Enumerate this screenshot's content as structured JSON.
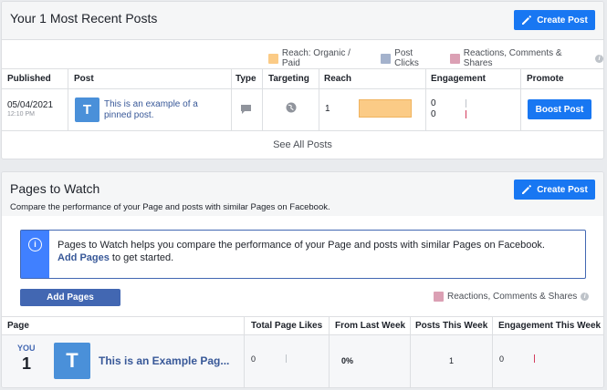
{
  "recent_posts": {
    "title": "Your 1 Most Recent Posts",
    "create_post_label": "Create Post",
    "legend": [
      {
        "label": "Reach: Organic / Paid",
        "color": "#fbcb86"
      },
      {
        "label": "Post Clicks",
        "color": "#a4b2cc"
      },
      {
        "label": "Reactions, Comments & Shares",
        "color": "#dba0b4"
      }
    ],
    "columns": [
      "Published",
      "Post",
      "Type",
      "Targeting",
      "Reach",
      "Engagement",
      "Promote"
    ],
    "row": {
      "date": "05/04/2021",
      "time": "12:10 PM",
      "avatar_letter": "T",
      "post_text": "This is an example of a pinned post.",
      "reach": "1",
      "reach_fraction": 1.0,
      "engagement_clicks": "0",
      "engagement_reactions": "0",
      "boost_label": "Boost Post"
    },
    "see_all_label": "See All Posts"
  },
  "pages_to_watch": {
    "title": "Pages to Watch",
    "subtitle": "Compare the performance of your Page and posts with similar Pages on Facebook.",
    "create_post_label": "Create Post",
    "info_text": "Pages to Watch helps you compare the performance of your Page and posts with similar Pages on Facebook.",
    "info_link": "Add Pages",
    "info_suffix": " to get started.",
    "add_pages_label": "Add Pages",
    "legend_label": "Reactions, Comments & Shares",
    "legend_color": "#dba0b4",
    "columns": [
      "Page",
      "Total Page Likes",
      "From Last Week",
      "Posts This Week",
      "Engagement This Week"
    ],
    "row": {
      "you_label": "YOU",
      "rank": "1",
      "avatar_letter": "T",
      "page_name": "This is an Example Pag...",
      "total_likes": "0",
      "from_last_week": "0%",
      "posts_this_week": "1",
      "engagement": "0"
    }
  },
  "colors": {
    "accent": "#1877f2",
    "button_dark": "#4267b2",
    "link": "#385898",
    "info_blue": "#4080ff"
  }
}
